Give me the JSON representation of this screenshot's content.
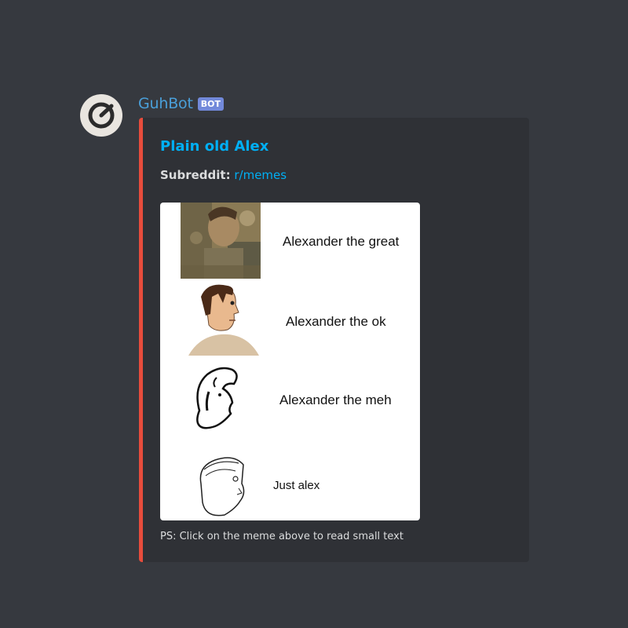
{
  "message": {
    "username": "GuhBot",
    "bot_tag": "BOT",
    "username_color": "#4a9fd9"
  },
  "embed": {
    "accent_color": "#e74c3c",
    "title": "Plain old Alex",
    "subreddit_label": "Subreddit:",
    "subreddit_link": "r/memes",
    "footer": "PS: Click on the meme above to read small text",
    "meme": {
      "rows": [
        {
          "caption": "Alexander the great",
          "picture": "mosaic-portrait"
        },
        {
          "caption": "Alexander the ok",
          "picture": "crude-colored-portrait"
        },
        {
          "caption": "Alexander the meh",
          "picture": "line-sketch-portrait"
        },
        {
          "caption": "Just alex",
          "picture": "scribble-portrait"
        }
      ]
    }
  }
}
